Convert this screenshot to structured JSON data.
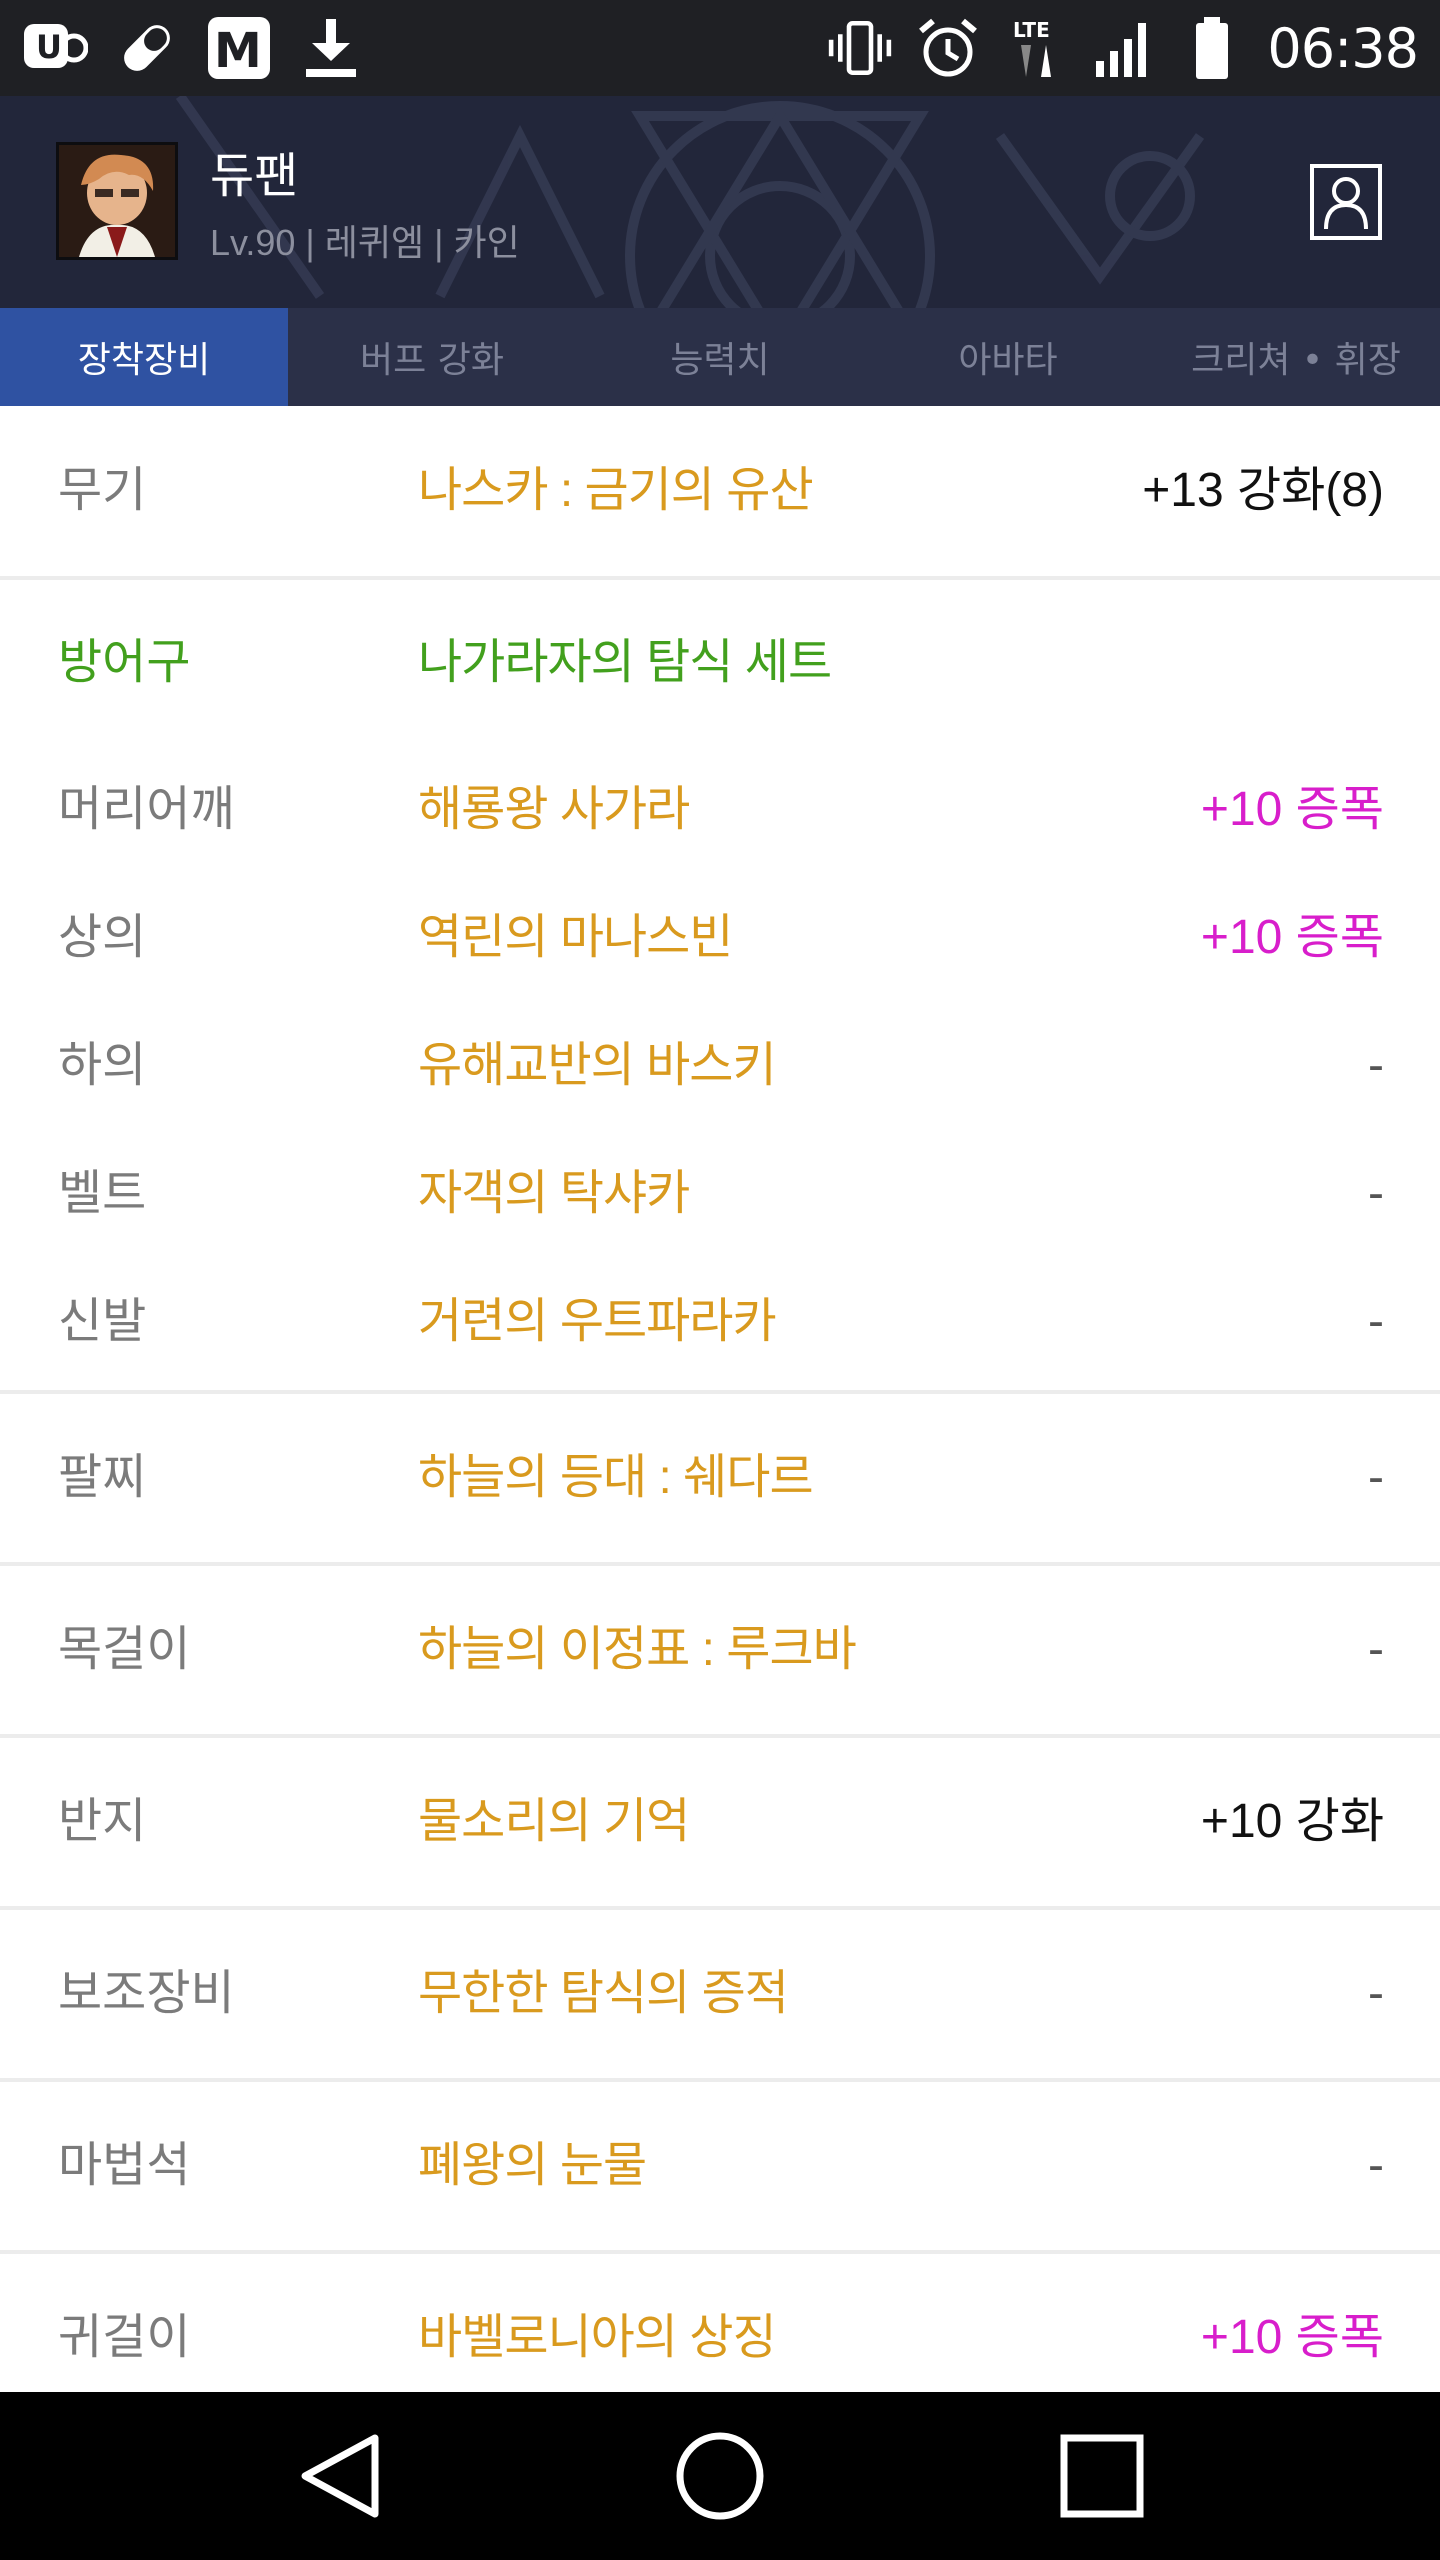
{
  "status_bar": {
    "time": "06:38",
    "icons": [
      "uplus-icon",
      "pill-icon",
      "mnet-icon",
      "download-icon",
      "vibrate-icon",
      "alarm-icon",
      "lte-icon",
      "signal-icon",
      "battery-icon"
    ]
  },
  "profile": {
    "name": "듀팬",
    "subtitle": "Lv.90 | 레퀴엠 | 카인"
  },
  "tabs": [
    {
      "label": "장착장비",
      "active": true
    },
    {
      "label": "버프 강화",
      "active": false
    },
    {
      "label": "능력치",
      "active": false
    },
    {
      "label": "아바타",
      "active": false
    },
    {
      "label": "크리쳐 • 휘장",
      "active": false
    }
  ],
  "equipment": {
    "weapon": {
      "slot": "무기",
      "item": "나스카 : 금기의 유산",
      "enh": "+13 강화(8)"
    },
    "armor_set": {
      "slot": "방어구",
      "item": "나가라자의 탐식 세트"
    },
    "armor": [
      {
        "slot": "머리어깨",
        "item": "해룡왕 사가라",
        "enh": "+10 증폭"
      },
      {
        "slot": "상의",
        "item": "역린의 마나스빈",
        "enh": "+10 증폭"
      },
      {
        "slot": "하의",
        "item": "유해교반의 바스키",
        "enh": "-"
      },
      {
        "slot": "벨트",
        "item": "자객의 탁샤카",
        "enh": "-"
      },
      {
        "slot": "신발",
        "item": "거련의 우트파라카",
        "enh": "-"
      }
    ],
    "bracelet": {
      "slot": "팔찌",
      "item": "하늘의 등대 : 쉐다르",
      "enh": "-"
    },
    "necklace": {
      "slot": "목걸이",
      "item": "하늘의 이정표 : 루크바",
      "enh": "-"
    },
    "ring": {
      "slot": "반지",
      "item": "물소리의 기억",
      "enh": "+10 강화"
    },
    "sub": {
      "slot": "보조장비",
      "item": "무한한 탐식의 증적",
      "enh": "-"
    },
    "magic_stone": {
      "slot": "마법석",
      "item": "폐왕의 눈물",
      "enh": "-"
    },
    "earring": {
      "slot": "귀걸이",
      "item": "바벨로니아의 상징",
      "enh": "+10 증폭"
    }
  },
  "colors": {
    "item_gold": "#d99a1e",
    "set_green": "#42a01d",
    "amplify_purple": "#d81ecb",
    "tab_active": "#2f52a2"
  }
}
